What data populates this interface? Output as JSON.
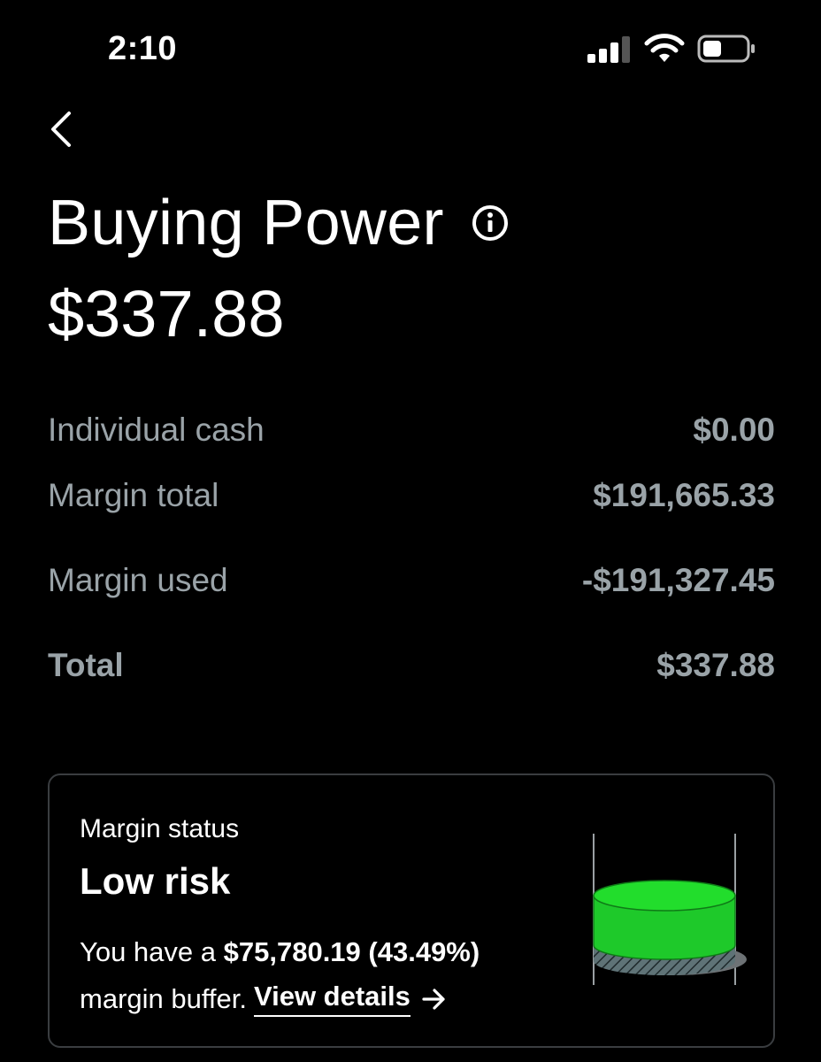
{
  "status_bar": {
    "time": "2:10"
  },
  "header": {
    "title": "Buying Power",
    "amount": "$337.88"
  },
  "breakdown": [
    {
      "label": "Individual cash",
      "value": "$0.00"
    },
    {
      "label": "Margin total",
      "value": "$191,665.33"
    },
    {
      "label": "Margin used",
      "value": "-$191,327.45"
    },
    {
      "label": "Total",
      "value": "$337.88"
    }
  ],
  "margin_card": {
    "label": "Margin status",
    "risk": "Low risk",
    "text_prefix": "You have a",
    "buffer_amount": "$75,780.19 (43.49%)",
    "text_suffix": "margin buffer.",
    "link": "View details"
  },
  "colors": {
    "background": "#000000",
    "muted_text": "#9aa3a8",
    "accent_green": "#22d62b"
  },
  "icons": {
    "back": "chevron-left-icon",
    "info": "info-icon",
    "link_arrow": "arrow-right-icon"
  }
}
